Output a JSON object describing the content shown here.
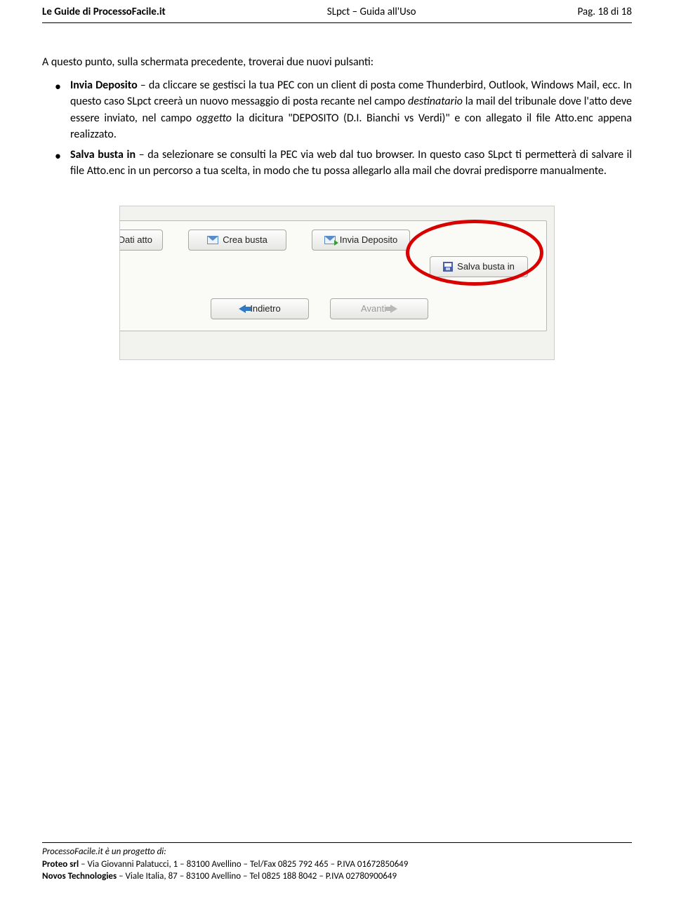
{
  "header": {
    "left": "Le Guide di ProcessoFacile.it",
    "center": "SLpct – Guida all'Uso",
    "right": "Pag. 18 di 18"
  },
  "content": {
    "intro": "A questo punto, sulla schermata precedente, troverai due nuovi pulsanti:",
    "bullet1": {
      "lead": "Invia Deposito",
      "sep": " – ",
      "text1": "da cliccare se gestisci la tua PEC con un client di posta come Thunderbird, Outlook, Windows Mail, ecc. In questo caso SLpct creerà un nuovo messaggio di posta recante nel campo ",
      "italic1": "destinatario",
      "text2": " la mail del tribunale dove l'atto deve essere inviato, nel campo ",
      "italic2": "oggetto",
      "text3": " la dicitura \"DEPOSITO (D.I. Bianchi vs Verdi)\" e con allegato il file Atto.enc appena realizzato."
    },
    "bullet2": {
      "lead": "Salva busta in",
      "sep": " – ",
      "text": "da selezionare se consulti la PEC via web dal tuo browser. In questo caso SLpct ti permetterà di salvare il file Atto.enc in un percorso a tua scelta, in modo che tu possa allegarlo alla mail che dovrai predisporre manualmente."
    }
  },
  "screenshot": {
    "buttons": {
      "dati_atto": "Dati atto",
      "crea_busta": "Crea busta",
      "invia_deposito": "Invia Deposito",
      "salva_busta_in": "Salva busta in",
      "indietro": "Indietro",
      "avanti": "Avanti"
    }
  },
  "footer": {
    "lead": "ProcessoFacile.it è un progetto di:",
    "line1_company": "Proteo srl",
    "line1_rest": " – Via Giovanni Palatucci, 1 – 83100 Avellino – Tel/Fax 0825 792 465 – P.IVA 01672850649",
    "line2_company": "Novos Technologies",
    "line2_rest": " – Viale Italia, 87 – 83100 Avellino – Tel 0825 188 8042 – P.IVA 02780900649"
  }
}
